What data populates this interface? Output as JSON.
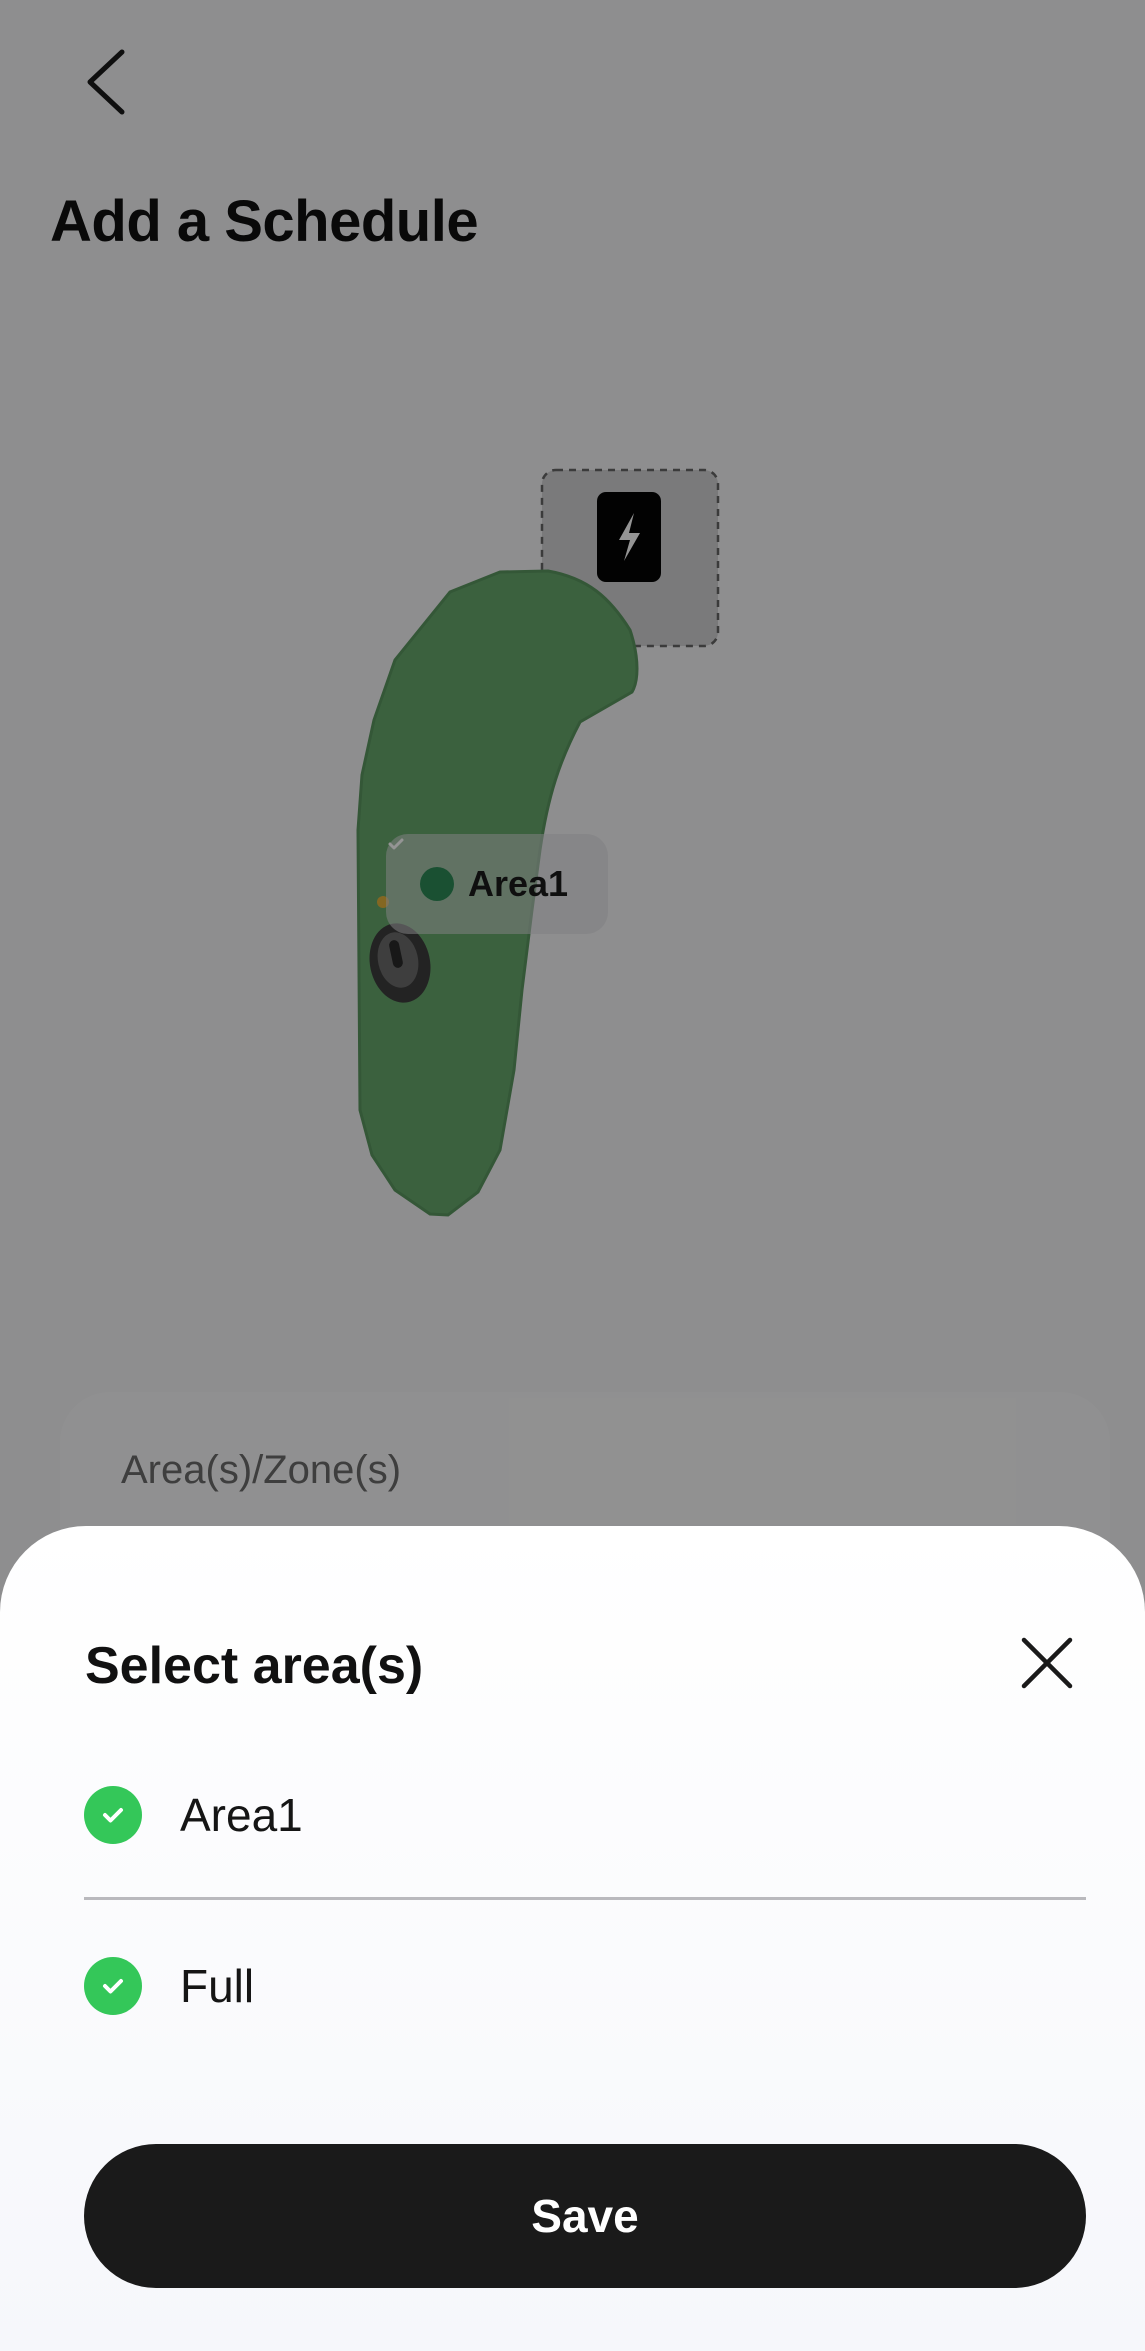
{
  "header": {
    "back_icon": "chevron-left-icon",
    "title": "Add a Schedule"
  },
  "map": {
    "area_label": "Area1",
    "lawn_color": "#66a86c",
    "charging_station_icon": "lightning-bolt-icon",
    "mower_icon": "mower-icon"
  },
  "zone_card": {
    "label": "Area(s)/Zone(s)"
  },
  "sheet": {
    "title": "Select area(s)",
    "close_icon": "close-icon",
    "options": [
      {
        "label": "Area1",
        "selected": true
      },
      {
        "label": "Full",
        "selected": true
      }
    ],
    "save_label": "Save"
  },
  "colors": {
    "check_green": "#34c759",
    "button_black": "#1a1a1a"
  }
}
